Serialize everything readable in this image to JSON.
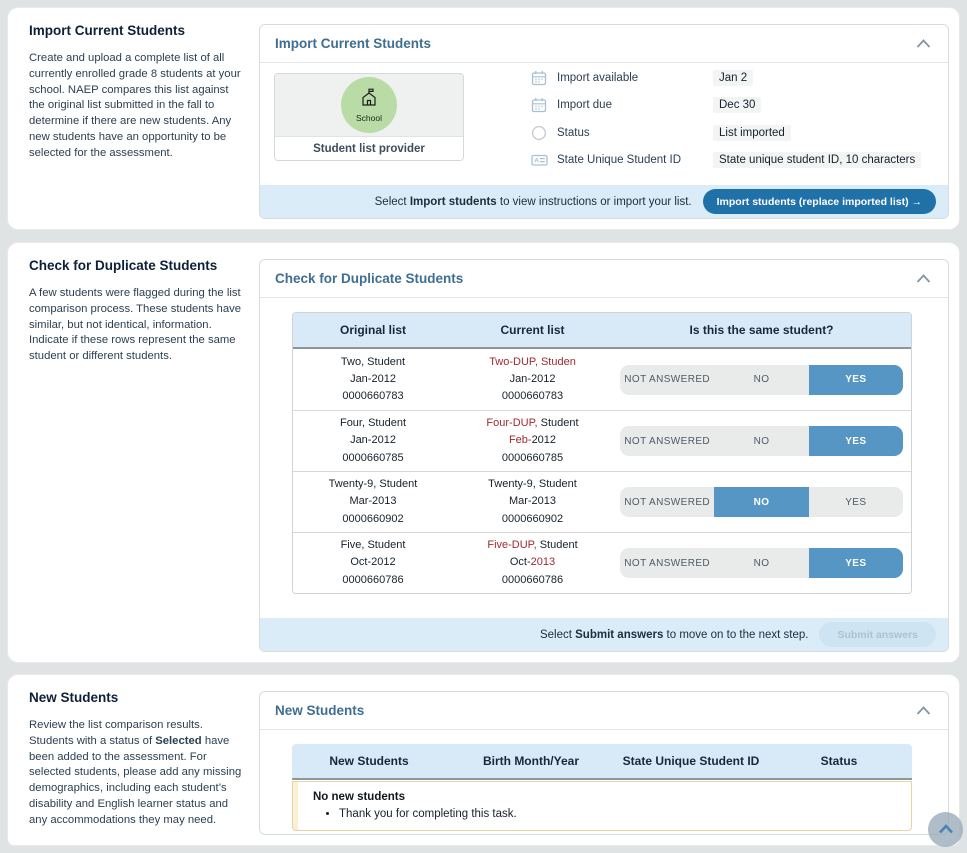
{
  "colors": {
    "page_bg": "#e0e3e3",
    "panel_title": "#3f6e90",
    "sidebar_heading": "#0e2038",
    "table_header_bg": "#d8eaf7",
    "footer_strip_bg": "#d9ecf8",
    "primary_button_bg": "#2171a9",
    "selected_toggle_bg": "#5596c4",
    "mismatch_red": "#a12931",
    "provider_circle_green": "#b9dca6"
  },
  "sections": {
    "import": {
      "sidebar_title": "Import Current Students",
      "sidebar_text": "Create and upload a complete list of all currently enrolled grade 8 students at your school. NAEP compares this list against the original list submitted in the fall to determine if there are new students. Any new students have an opportunity to be selected for the assessment.",
      "panel_title": "Import Current Students",
      "provider": {
        "icon": "school-icon",
        "circle_label": "School",
        "caption": "Student list provider"
      },
      "info_rows": [
        {
          "icon": "calendar-icon",
          "label": "Import available",
          "value": "Jan 2"
        },
        {
          "icon": "calendar-icon",
          "label": "Import due",
          "value": "Dec 30"
        },
        {
          "icon": "status-circle-icon",
          "label": "Status",
          "value": "List imported"
        },
        {
          "icon": "id-card-icon",
          "label": "State Unique Student ID",
          "value": "State unique student ID, 10 characters"
        }
      ],
      "footer": {
        "pre": "Select ",
        "bold": "Import students",
        "post": " to view instructions or import your list.",
        "button_label": "Import students (replace imported list)",
        "button_arrow": "→"
      }
    },
    "duplicates": {
      "sidebar_title": "Check for Duplicate Students",
      "sidebar_text": "A few students were flagged during the list comparison process. These students have similar, but not identical, information. Indicate if these rows represent the same student or different students.",
      "panel_title": "Check for Duplicate Students",
      "table_headers": [
        "Original list",
        "Current list",
        "Is this the same student?"
      ],
      "answer_options": [
        "NOT ANSWERED",
        "NO",
        "YES"
      ],
      "rows": [
        {
          "original": [
            "Two, Student",
            "Jan-2012",
            "0000660783"
          ],
          "current": [
            [
              {
                "t": "Two-DUP, Studen",
                "red": true
              }
            ],
            [
              {
                "t": "Jan-2012",
                "red": false
              }
            ],
            [
              {
                "t": "0000660783",
                "red": false
              }
            ]
          ],
          "answer": "YES",
          "selected_index": 2
        },
        {
          "original": [
            "Four, Student",
            "Jan-2012",
            "0000660785"
          ],
          "current": [
            [
              {
                "t": "Four-DUP,",
                "red": true
              },
              {
                "t": " Student",
                "red": false
              }
            ],
            [
              {
                "t": "Feb-",
                "red": true
              },
              {
                "t": "2012",
                "red": false
              }
            ],
            [
              {
                "t": "0000660785",
                "red": false
              }
            ]
          ],
          "answer": "YES",
          "selected_index": 2
        },
        {
          "original": [
            "Twenty-9, Student",
            "Mar-2013",
            "0000660902"
          ],
          "current": [
            [
              {
                "t": "Twenty-9, Student",
                "red": false
              }
            ],
            [
              {
                "t": "Mar-2013",
                "red": false
              }
            ],
            [
              {
                "t": "0000660902",
                "red": false
              }
            ]
          ],
          "answer": "NO",
          "selected_index": 1
        },
        {
          "original": [
            "Five, Student",
            "Oct-2012",
            "0000660786"
          ],
          "current": [
            [
              {
                "t": "Five-DUP,",
                "red": true
              },
              {
                "t": " Student",
                "red": false
              }
            ],
            [
              {
                "t": "Oct-",
                "red": false
              },
              {
                "t": "2013",
                "red": true
              }
            ],
            [
              {
                "t": "0000660786",
                "red": false
              }
            ]
          ],
          "answer": "YES",
          "selected_index": 2
        }
      ],
      "footer": {
        "pre": "Select ",
        "bold": "Submit answers",
        "post": " to move on to the next step.",
        "button_label": "Submit answers",
        "button_disabled": true
      }
    },
    "new_students": {
      "sidebar_title": "New Students",
      "sidebar_text_pre": "Review the list comparison results. Students with a status of ",
      "sidebar_text_bold": "Selected",
      "sidebar_text_post": " have been added to the assessment. For selected students, please add any missing demographics, including each student’s disability and English learner status and any accommodations they may need.",
      "panel_title": "New Students",
      "table_headers": [
        "New Students",
        "Birth Month/Year",
        "State Unique Student ID",
        "Status"
      ],
      "notice_title": "No new students",
      "notice_bullet": "Thank you for completing this task."
    }
  },
  "scroll_top": {
    "icon": "chevron-up-icon"
  }
}
